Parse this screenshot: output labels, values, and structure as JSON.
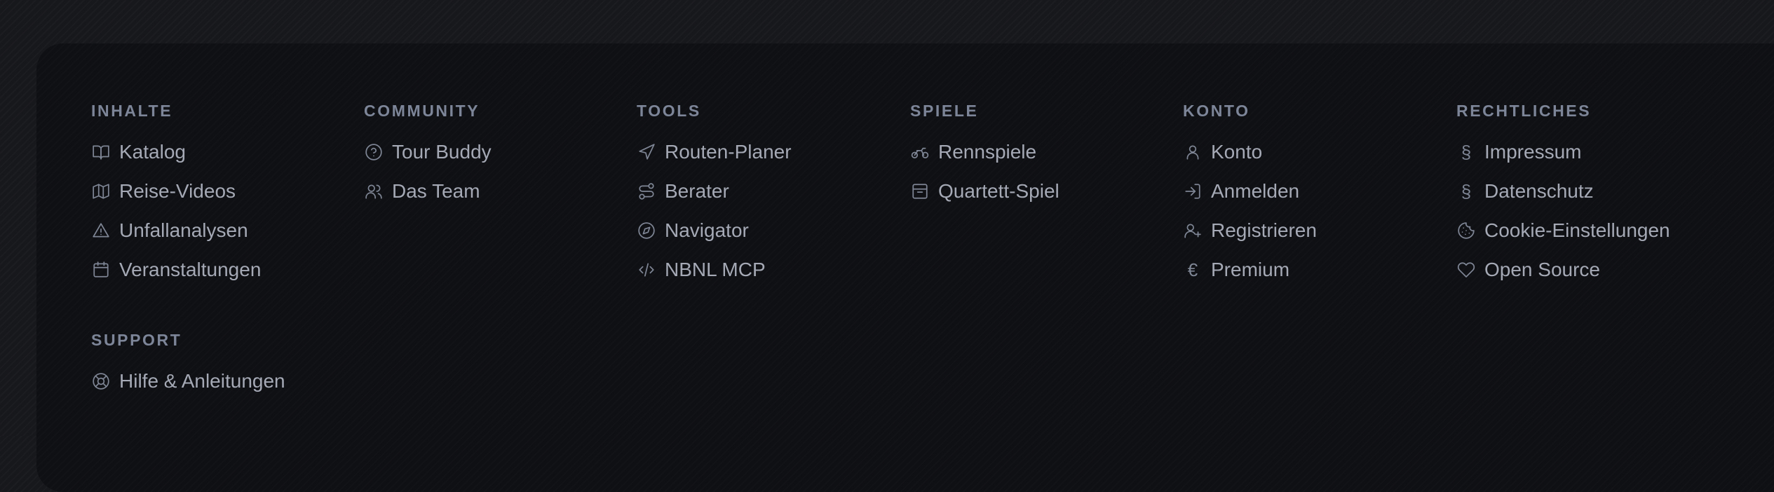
{
  "columns": [
    {
      "heading": "INHALTE",
      "items": [
        {
          "label": "Katalog",
          "icon": "book-open-icon"
        },
        {
          "label": "Reise-Videos",
          "icon": "map-icon"
        },
        {
          "label": "Unfallanalysen",
          "icon": "warning-triangle-icon"
        },
        {
          "label": "Veranstaltungen",
          "icon": "calendar-icon"
        }
      ]
    },
    {
      "heading": "COMMUNITY",
      "items": [
        {
          "label": "Tour Buddy",
          "icon": "help-circle-icon"
        },
        {
          "label": "Das Team",
          "icon": "users-icon"
        }
      ]
    },
    {
      "heading": "TOOLS",
      "items": [
        {
          "label": "Routen-Planer",
          "icon": "navigation-arrow-icon"
        },
        {
          "label": "Berater",
          "icon": "route-icon"
        },
        {
          "label": "Navigator",
          "icon": "compass-icon"
        },
        {
          "label": "NBNL MCP",
          "icon": "code-icon"
        }
      ]
    },
    {
      "heading": "SPIELE",
      "items": [
        {
          "label": "Rennspiele",
          "icon": "motorcycle-icon"
        },
        {
          "label": "Quartett-Spiel",
          "icon": "archive-box-icon"
        }
      ]
    },
    {
      "heading": "KONTO",
      "items": [
        {
          "label": "Konto",
          "icon": "user-icon"
        },
        {
          "label": "Anmelden",
          "icon": "log-in-icon"
        },
        {
          "label": "Registrieren",
          "icon": "user-plus-icon"
        },
        {
          "label": "Premium",
          "icon": "euro-icon"
        }
      ]
    },
    {
      "heading": "RECHTLICHES",
      "items": [
        {
          "label": "Impressum",
          "icon": "section-sign-icon"
        },
        {
          "label": "Datenschutz",
          "icon": "section-sign-icon"
        },
        {
          "label": "Cookie-Einstellungen",
          "icon": "cookie-icon"
        },
        {
          "label": "Open Source",
          "icon": "heart-icon"
        }
      ]
    }
  ],
  "support": {
    "heading": "SUPPORT",
    "items": [
      {
        "label": "Hilfe & Anleitungen",
        "icon": "life-buoy-icon"
      }
    ]
  },
  "colors": {
    "background": "#17181c",
    "panel": "#0f1013",
    "heading": "#7d8699",
    "link": "#a4a9b5",
    "icon": "#7e8594"
  }
}
